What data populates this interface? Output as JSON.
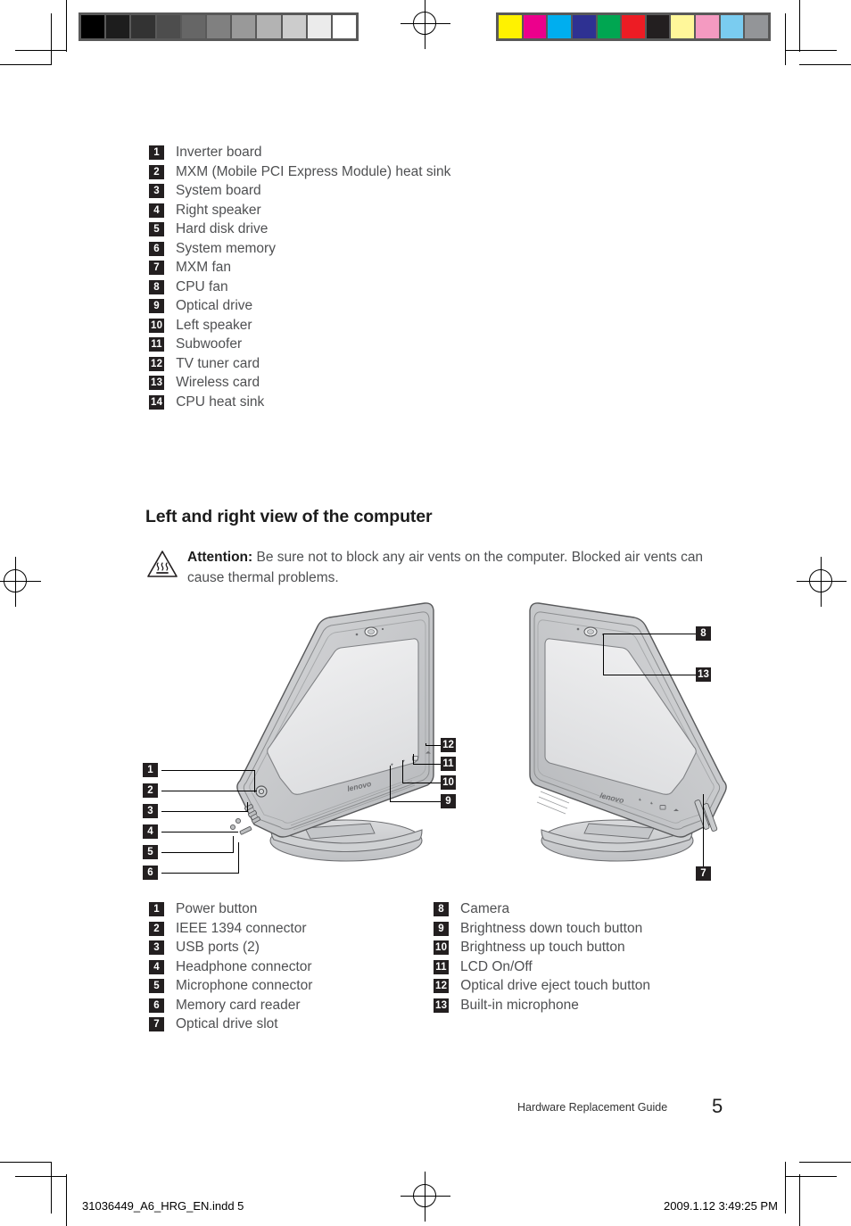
{
  "document": {
    "footer_text": "Hardware Replacement Guide",
    "page_number": "5",
    "slug": "31036449_A6_HRG_EN.indd   5",
    "timestamp": "2009.1.12   3:49:25 PM"
  },
  "components_list": {
    "items": [
      {
        "num": "1",
        "label": "Inverter board"
      },
      {
        "num": "2",
        "label": "MXM (Mobile PCI Express Module) heat sink"
      },
      {
        "num": "3",
        "label": "System board"
      },
      {
        "num": "4",
        "label": "Right speaker"
      },
      {
        "num": "5",
        "label": "Hard disk drive"
      },
      {
        "num": "6",
        "label": "System memory"
      },
      {
        "num": "7",
        "label": "MXM fan"
      },
      {
        "num": "8",
        "label": "CPU fan"
      },
      {
        "num": "9",
        "label": "Optical drive"
      },
      {
        "num": "10",
        "label": "Left speaker"
      },
      {
        "num": "11",
        "label": "Subwoofer"
      },
      {
        "num": "12",
        "label": "TV tuner card"
      },
      {
        "num": "13",
        "label": "Wireless card"
      },
      {
        "num": "14",
        "label": "CPU heat sink"
      }
    ]
  },
  "section": {
    "heading": "Left and right view of the computer",
    "attention_label": "Attention:",
    "attention_text": " Be sure not to block any air vents on the computer. Blocked air vents can cause thermal problems."
  },
  "legend_left": {
    "items": [
      {
        "num": "1",
        "label": "Power button"
      },
      {
        "num": "2",
        "label": "IEEE 1394 connector"
      },
      {
        "num": "3",
        "label": "USB ports (2)"
      },
      {
        "num": "4",
        "label": "Headphone connector"
      },
      {
        "num": "5",
        "label": "Microphone connector"
      },
      {
        "num": "6",
        "label": "Memory card reader"
      },
      {
        "num": "7",
        "label": "Optical drive slot"
      }
    ]
  },
  "legend_right": {
    "items": [
      {
        "num": "8",
        "label": "Camera"
      },
      {
        "num": "9",
        "label": "Brightness down touch button"
      },
      {
        "num": "10",
        "label": "Brightness up touch button"
      },
      {
        "num": "11",
        "label": "LCD On/Off"
      },
      {
        "num": "12",
        "label": "Optical drive eject touch button"
      },
      {
        "num": "13",
        "label": "Built-in microphone"
      }
    ]
  },
  "illustration_left": {
    "brand": "lenovo",
    "callouts": [
      {
        "num": "1"
      },
      {
        "num": "2"
      },
      {
        "num": "3"
      },
      {
        "num": "4"
      },
      {
        "num": "5"
      },
      {
        "num": "6"
      },
      {
        "num": "9"
      },
      {
        "num": "10"
      },
      {
        "num": "11"
      },
      {
        "num": "12"
      }
    ]
  },
  "illustration_right": {
    "brand": "lenovo",
    "callouts": [
      {
        "num": "8"
      },
      {
        "num": "13"
      },
      {
        "num": "7"
      }
    ]
  },
  "calibration": {
    "grayscale": [
      "#000000",
      "#1d1d1d",
      "#333333",
      "#4d4d4d",
      "#666666",
      "#808080",
      "#999999",
      "#b3b3b3",
      "#cccccc",
      "#ebebeb",
      "#ffffff"
    ],
    "colorbar": [
      "#fff200",
      "#ec008c",
      "#00aeef",
      "#2e3192",
      "#00a651",
      "#ed1c24",
      "#231f20",
      "#fff79a",
      "#f49ac1",
      "#7accf0",
      "#939598"
    ]
  }
}
